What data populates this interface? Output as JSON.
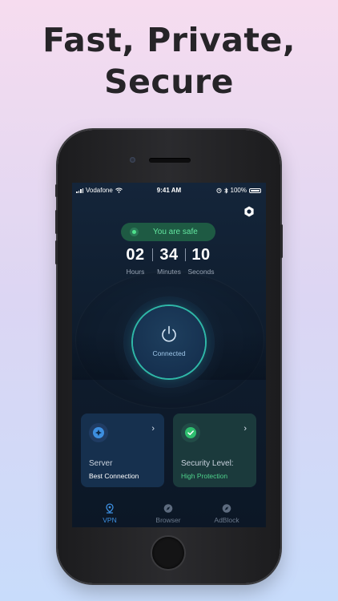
{
  "headline": {
    "line1": "Fast, Private,",
    "line2": "Secure"
  },
  "status_bar": {
    "carrier": "Vodafone",
    "time": "9:41 AM",
    "battery": "100%"
  },
  "safe_status": {
    "text": "You are safe"
  },
  "timer": {
    "hours": "02",
    "hours_label": "Hours",
    "minutes": "34",
    "minutes_label": "Minutes",
    "seconds": "10",
    "seconds_label": "Seconds"
  },
  "power": {
    "label": "Connected"
  },
  "cards": {
    "server": {
      "title": "Server",
      "subtitle": "Best Connection"
    },
    "security": {
      "title": "Security Level:",
      "subtitle": "High Protection"
    }
  },
  "tabs": [
    {
      "label": "VPN",
      "icon": "location-pin-icon"
    },
    {
      "label": "Browser",
      "icon": "compass-icon"
    },
    {
      "label": "AdBlock",
      "icon": "compass-icon"
    }
  ],
  "colors": {
    "accent_green": "#4fd28c",
    "accent_blue": "#3d8fe0",
    "ring": "#2fb8a8",
    "screen_bg": "#0f1d2e"
  }
}
